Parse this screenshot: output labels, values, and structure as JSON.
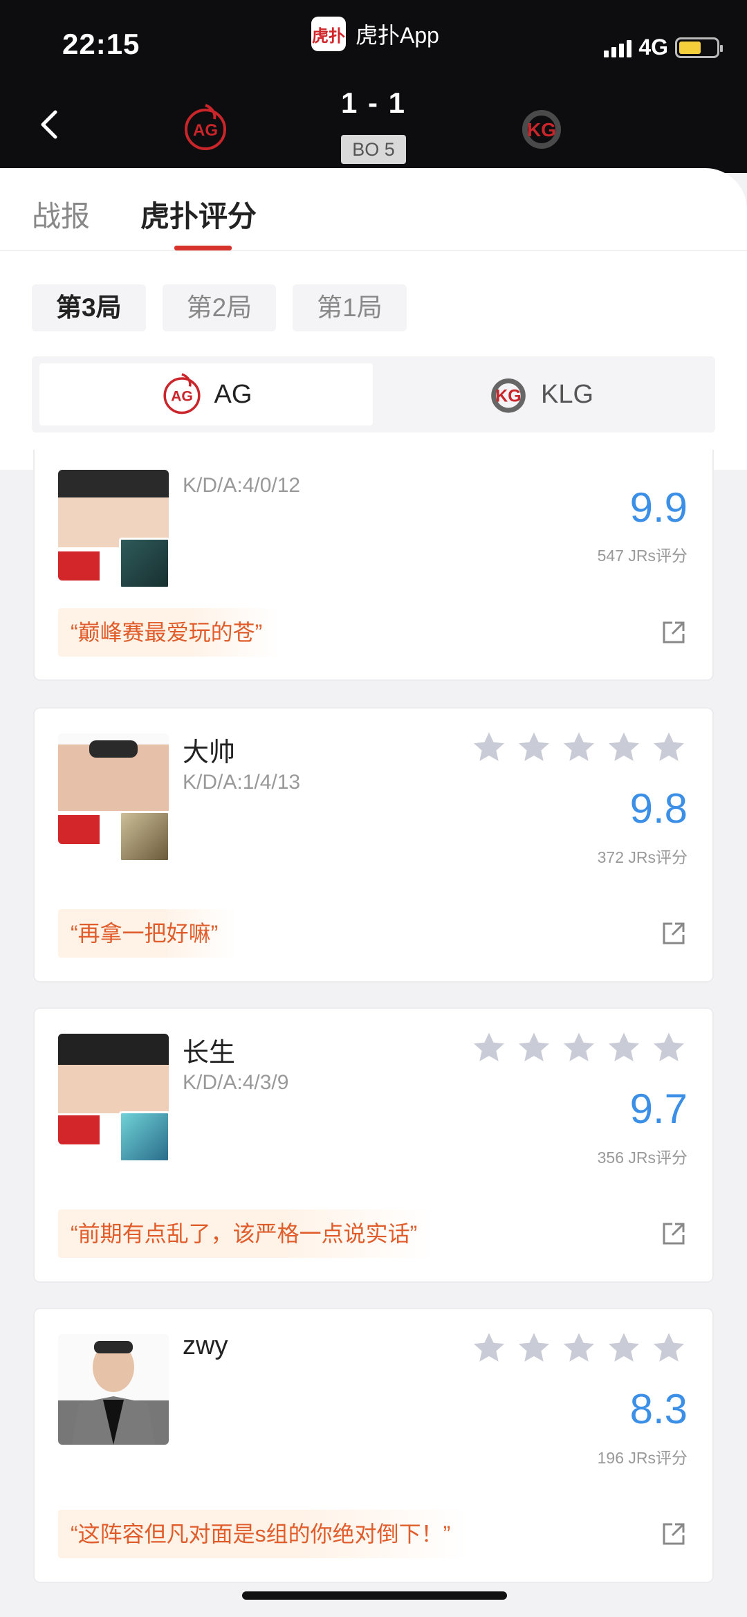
{
  "status_bar": {
    "time": "22:15",
    "app_name": "虎扑App",
    "app_logo_text": "虎扑",
    "network": "4G",
    "battery_level_percent": 60
  },
  "match": {
    "score": "1 - 1",
    "format": "BO 5",
    "team_left_logo_text": "AG",
    "team_right_logo_text": "KG"
  },
  "tabs": [
    {
      "label": "战报",
      "active": false
    },
    {
      "label": "虎扑评分",
      "active": true
    }
  ],
  "rounds": [
    {
      "label": "第3局",
      "active": true
    },
    {
      "label": "第2局",
      "active": false
    },
    {
      "label": "第1局",
      "active": false
    }
  ],
  "team_selector": {
    "left": {
      "label": "AG",
      "active": true
    },
    "right": {
      "label": "KLG",
      "active": false
    }
  },
  "players": [
    {
      "name": "",
      "kda": "K/D/A:4/0/12",
      "rating": "9.9",
      "votes": "547 JRs评分",
      "quote": "“巅峰赛最爱玩的苍”"
    },
    {
      "name": "大帅",
      "kda": "K/D/A:1/4/13",
      "rating": "9.8",
      "votes": "372 JRs评分",
      "quote": "“再拿一把好嘛”"
    },
    {
      "name": "长生",
      "kda": "K/D/A:4/3/9",
      "rating": "9.7",
      "votes": "356 JRs评分",
      "quote": "“前期有点乱了，该严格一点说实话”"
    },
    {
      "name": "zwy",
      "kda": "",
      "rating": "8.3",
      "votes": "196 JRs评分",
      "quote": "“这阵容但凡对面是s组的你绝对倒下！”"
    }
  ],
  "colors": {
    "accent_red": "#d6332b",
    "rating_blue": "#3b8fe6",
    "quote_orange": "#e05c2a"
  }
}
